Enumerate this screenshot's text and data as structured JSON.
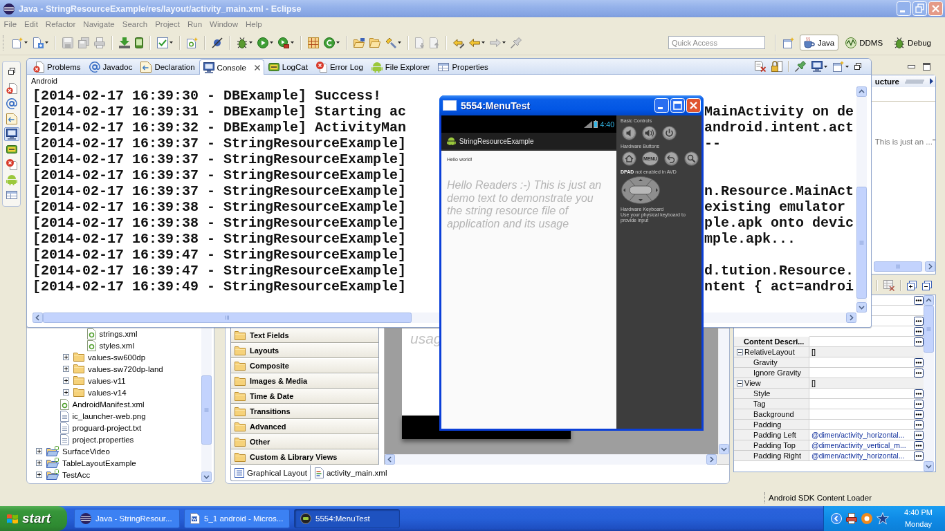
{
  "window": {
    "title": "Java - StringResourceExample/res/layout/activity_main.xml - Eclipse"
  },
  "menu_bar": [
    "File",
    "Edit",
    "Refactor",
    "Navigate",
    "Search",
    "Project",
    "Run",
    "Window",
    "Help"
  ],
  "toolbar": {
    "quick_access": {
      "placeholder": "Quick Access"
    },
    "perspectives": [
      {
        "label": "Java",
        "kind": "java",
        "selected": true
      },
      {
        "label": "DDMS",
        "kind": "ddms",
        "selected": false
      },
      {
        "label": "Debug",
        "kind": "debug",
        "selected": false
      }
    ]
  },
  "fast_view_bar": [
    {
      "kind": "problems",
      "selected": false
    },
    {
      "kind": "javadoc",
      "selected": false
    },
    {
      "kind": "declaration",
      "selected": false
    },
    {
      "kind": "console",
      "selected": true
    },
    {
      "kind": "logcat",
      "selected": false
    },
    {
      "kind": "error_log",
      "selected": false
    },
    {
      "kind": "file_explorer",
      "selected": false
    },
    {
      "kind": "properties",
      "selected": false
    }
  ],
  "console_view": {
    "tabs": [
      {
        "label": "Problems",
        "kind": "problems",
        "selected": false
      },
      {
        "label": "Javadoc",
        "kind": "javadoc",
        "selected": false
      },
      {
        "label": "Declaration",
        "kind": "declaration",
        "selected": false
      },
      {
        "label": "Console",
        "kind": "console",
        "selected": true
      },
      {
        "label": "LogCat",
        "kind": "logcat",
        "selected": false
      },
      {
        "label": "Error Log",
        "kind": "error_log",
        "selected": false
      },
      {
        "label": "File Explorer",
        "kind": "file_explorer",
        "selected": false
      },
      {
        "label": "Properties",
        "kind": "properties",
        "selected": false
      }
    ],
    "console_name": "Android",
    "lines": [
      {
        "text": "[2014-02-17 16:39:30 - DBExample] Success!"
      },
      {
        "text": "[2014-02-17 16:39:31 - DBExample] Starting ac",
        "tail": "MainActivity on de"
      },
      {
        "text": "[2014-02-17 16:39:32 - DBExample] ActivityMan",
        "tail": "android.intent.act"
      },
      {
        "text": "[2014-02-17 16:39:37 - StringResourceExample]",
        "tail": "--"
      },
      {
        "text": "[2014-02-17 16:39:37 - StringResourceExample]"
      },
      {
        "text": "[2014-02-17 16:39:37 - StringResourceExample]"
      },
      {
        "text": "[2014-02-17 16:39:37 - StringResourceExample]",
        "tail": "n.Resource.MainAct"
      },
      {
        "text": "[2014-02-17 16:39:38 - StringResourceExample]",
        "tail": "existing emulator"
      },
      {
        "text": "[2014-02-17 16:39:38 - StringResourceExample]",
        "tail": "ple.apk onto devic"
      },
      {
        "text": "[2014-02-17 16:39:38 - StringResourceExample]",
        "tail": "mple.apk..."
      },
      {
        "text": "[2014-02-17 16:39:47 - StringResourceExample]"
      },
      {
        "text": "[2014-02-17 16:39:47 - StringResourceExample]",
        "tail": "d.tution.Resource."
      },
      {
        "text": "[2014-02-17 16:39:49 - StringResourceExample]",
        "tail": "ntent { act=androi"
      }
    ]
  },
  "project_explorer": {
    "tree": [
      {
        "children": [
          {
            "children": [
              {
                "children": [
                  {
                    "label": "strings.xml",
                    "kind": "xml_file"
                  },
                  {
                    "label": "styles.xml",
                    "kind": "xml_file"
                  }
                ]
              },
              {
                "label": "values-sw600dp",
                "kind": "folder",
                "expanded": false
              },
              {
                "label": "values-sw720dp-land",
                "kind": "folder",
                "expanded": false
              },
              {
                "label": "values-v11",
                "kind": "folder",
                "expanded": false
              },
              {
                "label": "values-v14",
                "kind": "folder",
                "expanded": false
              }
            ]
          },
          {
            "label": "AndroidManifest.xml",
            "kind": "xml_file"
          },
          {
            "label": "ic_launcher-web.png",
            "kind": "file"
          },
          {
            "label": "proguard-project.txt",
            "kind": "file"
          },
          {
            "label": "project.properties",
            "kind": "file"
          }
        ]
      },
      {
        "label": "SurfaceVideo",
        "kind": "project",
        "expanded": false
      },
      {
        "label": "TableLayoutExample",
        "kind": "project",
        "expanded": false
      },
      {
        "label": "TestAcc",
        "kind": "project",
        "expanded": false
      }
    ]
  },
  "palette": {
    "categories": [
      "Text Fields",
      "Layouts",
      "Composite",
      "Images & Media",
      "Time & Date",
      "Transitions",
      "Advanced",
      "Other",
      "Custom & Library Views"
    ]
  },
  "layout_preview": {
    "text": "usag"
  },
  "editor_tabs": [
    {
      "label": "Graphical Layout",
      "kind": "layout",
      "selected": true
    },
    {
      "label": "activity_main.xml",
      "kind": "xml",
      "selected": false
    }
  ],
  "outline": {
    "title": "ucture",
    "item": "This is just an ...\""
  },
  "properties": {
    "rows": [
      {
        "kind": "property",
        "button": true
      },
      {
        "kind": "property",
        "button": false
      },
      {
        "kind": "property",
        "button": true
      },
      {
        "kind": "property",
        "button": true
      },
      {
        "kind": "important",
        "label": "Content Descri...",
        "button": true
      },
      {
        "kind": "category",
        "label": "RelativeLayout",
        "value": "[]",
        "expanded": true,
        "children": [
          {
            "kind": "property",
            "label": "Gravity",
            "button": true
          },
          {
            "kind": "property",
            "label": "Ignore Gravity",
            "button": true
          }
        ]
      },
      {
        "kind": "category",
        "label": "View",
        "value": "[]",
        "expanded": true,
        "children": [
          {
            "kind": "property",
            "label": "Style",
            "button": true
          },
          {
            "kind": "property",
            "label": "Tag",
            "button": true
          },
          {
            "kind": "property",
            "label": "Background",
            "button": true
          },
          {
            "kind": "property",
            "label": "Padding",
            "button": true
          },
          {
            "kind": "property",
            "label": "Padding Left",
            "value": "@dimen/activity_horizontal...",
            "button": true
          },
          {
            "kind": "property",
            "label": "Padding Top",
            "value": "@dimen/activity_vertical_m...",
            "button": true
          },
          {
            "kind": "property",
            "label": "Padding Right",
            "value": "@dimen/activity_horizontal...",
            "button": true
          }
        ]
      }
    ]
  },
  "status_bar": {
    "message": "Android SDK Content Loader"
  },
  "emulator": {
    "title": "5554:MenuTest",
    "phone": {
      "clock": "4:40",
      "app_title": "StringResourceExample",
      "texts": [
        {
          "kind": "small",
          "text": "Hello world!"
        },
        {
          "kind": "large",
          "text": "Hello Readers :-) This is just an demo text to demonstrate you the string resource file of application and its usage"
        }
      ]
    },
    "controls": [
      {
        "kind": "label",
        "text": "Basic Controls"
      },
      {
        "kind": "buttons",
        "buttons": [
          {
            "kind": "volume_down"
          },
          {
            "kind": "volume_up"
          },
          {
            "kind": "power"
          }
        ]
      },
      {
        "kind": "label",
        "text": "Hardware Buttons"
      },
      {
        "kind": "buttons",
        "buttons": [
          {
            "kind": "home"
          },
          {
            "kind": "menu",
            "label": "MENU"
          },
          {
            "kind": "back"
          },
          {
            "kind": "search"
          }
        ]
      },
      {
        "kind": "label",
        "text": "**DPAD** not enabled in AVD"
      },
      {
        "kind": "dpad"
      },
      {
        "kind": "label",
        "text": "Hardware Keyboard"
      },
      {
        "kind": "label",
        "text": "Use your physical keyboard to provide input"
      }
    ]
  },
  "taskbar": {
    "start": "start",
    "tasks": [
      {
        "label": "Java - StringResour...",
        "kind": "eclipse",
        "selected": false
      },
      {
        "label": "5_1 android - Micros...",
        "kind": "document",
        "selected": false
      },
      {
        "label": "5554:MenuTest",
        "kind": "emulator",
        "selected": true
      }
    ],
    "clock": "4:40 PM",
    "day": "Monday"
  }
}
